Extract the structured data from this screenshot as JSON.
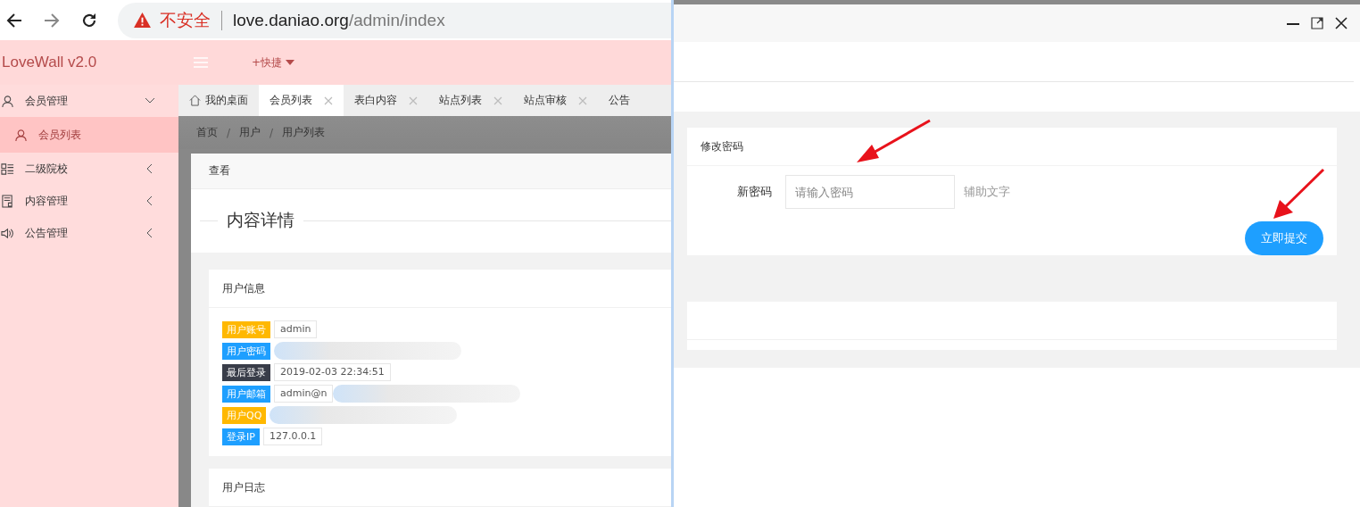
{
  "browser": {
    "security_label": "不安全",
    "url_host": "love.daniao.org",
    "url_path": "/admin/index"
  },
  "header": {
    "logo": "LoveWall v2.0",
    "quick_menu": "+快捷"
  },
  "sidebar": {
    "items": [
      {
        "label": "会员管理",
        "expanded": true,
        "children": [
          {
            "label": "会员列表",
            "selected": true
          }
        ]
      },
      {
        "label": "二级院校",
        "expanded": false
      },
      {
        "label": "内容管理",
        "expanded": false
      },
      {
        "label": "公告管理",
        "expanded": false
      }
    ]
  },
  "tabs": [
    {
      "label": "我的桌面",
      "kind": "home",
      "selected": false,
      "closable": false
    },
    {
      "label": "会员列表",
      "kind": "page",
      "selected": true,
      "closable": true
    },
    {
      "label": "表白内容",
      "kind": "page",
      "selected": false,
      "closable": true
    },
    {
      "label": "站点列表",
      "kind": "page",
      "selected": false,
      "closable": true
    },
    {
      "label": "站点审核",
      "kind": "page",
      "selected": false,
      "closable": true
    },
    {
      "label": "公告",
      "kind": "page",
      "selected": false,
      "closable": false
    }
  ],
  "breadcrumb": {
    "separator": "/",
    "items": [
      "首页",
      "用户",
      "用户列表"
    ]
  },
  "panel": {
    "title": "查看",
    "section_title": "内容详情",
    "user_info": {
      "title": "用户信息",
      "fields": [
        {
          "label": "用户账号",
          "color": "#ffb800",
          "value": "admin",
          "redacted": false
        },
        {
          "label": "用户密码",
          "color": "#1e9fff",
          "redacted": true
        },
        {
          "label": "最后登录",
          "color": "#393d49",
          "value": "2019-02-03 22:34:51",
          "redacted": false
        },
        {
          "label": "用户邮箱",
          "color": "#1e9fff",
          "value": "admin@n",
          "redacted": true
        },
        {
          "label": "用户QQ",
          "color": "#ffb800",
          "redacted": true
        },
        {
          "label": "登录IP",
          "color": "#1e9fff",
          "value": "127.0.0.1",
          "redacted": false
        }
      ]
    },
    "log": {
      "title": "用户日志"
    }
  },
  "dialog": {
    "card_title": "修改密码",
    "field_label": "新密码",
    "placeholder": "请输入密码",
    "helper": "辅助文字",
    "submit": "立即提交"
  }
}
